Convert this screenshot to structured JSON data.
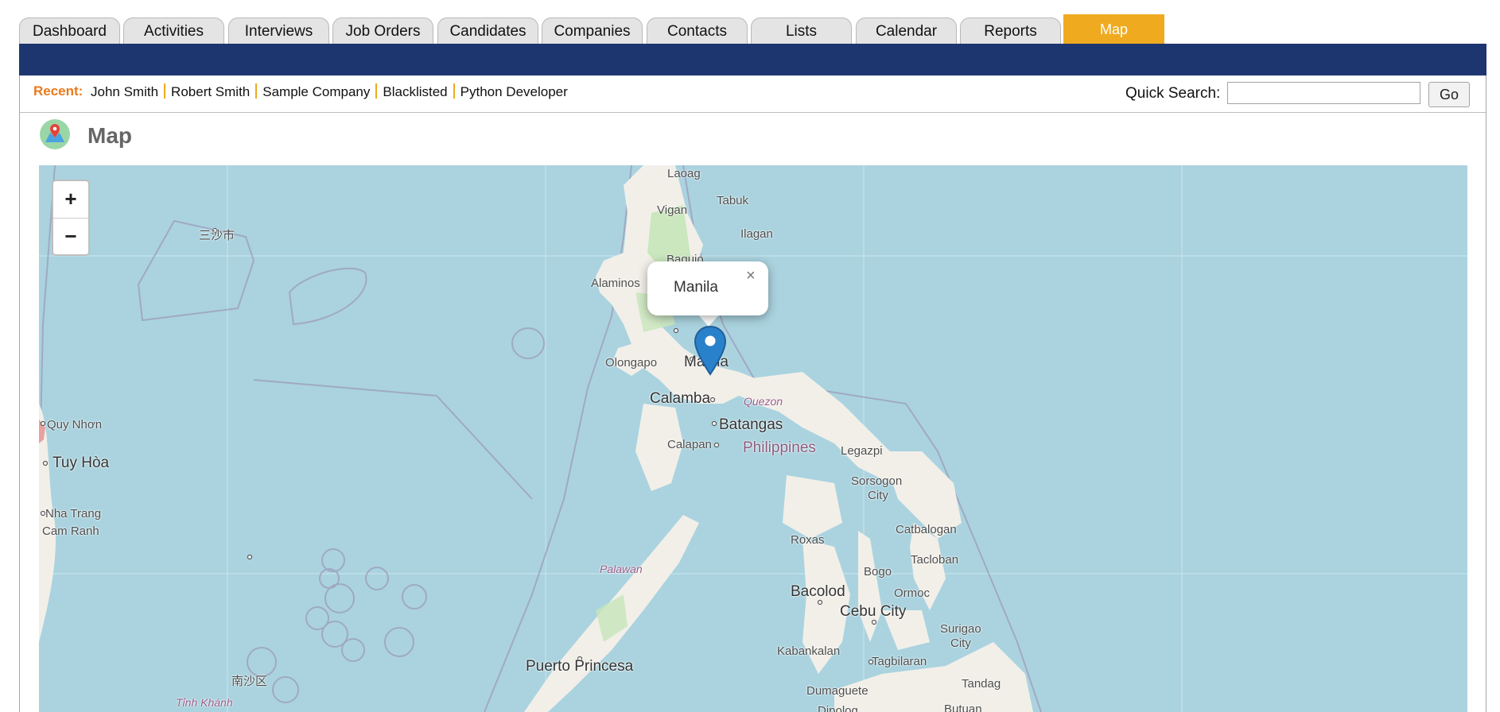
{
  "tabs": [
    {
      "label": "Dashboard"
    },
    {
      "label": "Activities"
    },
    {
      "label": "Interviews"
    },
    {
      "label": "Job Orders"
    },
    {
      "label": "Candidates"
    },
    {
      "label": "Companies"
    },
    {
      "label": "Contacts"
    },
    {
      "label": "Lists"
    },
    {
      "label": "Calendar"
    },
    {
      "label": "Reports"
    },
    {
      "label": "Map",
      "active": true
    }
  ],
  "recent": {
    "label": "Recent:",
    "items": [
      "John Smith",
      "Robert Smith",
      "Sample Company",
      "Blacklisted",
      "Python Developer"
    ]
  },
  "quick_search": {
    "label": "Quick Search:",
    "value": "",
    "button": "Go"
  },
  "page": {
    "title": "Map",
    "icon": "map-pin-icon"
  },
  "map": {
    "zoom_in": "+",
    "zoom_out": "−",
    "popup": {
      "text": "Manila",
      "close": "×"
    },
    "labels": {
      "laoag": "Laoag",
      "vigan": "Vigan",
      "tabuk": "Tabuk",
      "ilagan": "Ilagan",
      "baguio": "Baguio",
      "alaminos": "Alaminos",
      "olongapo": "Olongapo",
      "manila": "Manila",
      "calamba": "Calamba",
      "quezon": "Quezon",
      "batangas": "Batangas",
      "calapan": "Calapan",
      "philippines": "Philippines",
      "legazpi": "Legazpi",
      "sorsogon": "Sorsogon",
      "city": "City",
      "catbalogan": "Catbalogan",
      "tacloban": "Tacloban",
      "roxas": "Roxas",
      "bogo": "Bogo",
      "ormoc": "Ormoc",
      "bacolod": "Bacolod",
      "cebu": "Cebu City",
      "surigao": "Surigao",
      "surigao_city": "City",
      "palawan": "Palawan",
      "puerto": "Puerto Princesa",
      "kabankalan": "Kabankalan",
      "tagbilaran": "Tagbilaran",
      "tandag": "Tandag",
      "dumaguete": "Dumaguete",
      "dipolog": "Dipolog",
      "butuan": "Butuan",
      "sansha": "三沙市",
      "nansha": "南沙区",
      "tinhkhanh": "Tỉnh Khánh",
      "quynhon": "Quy Nhơn",
      "tuyhoa": "Tuy Hòa",
      "nhatrang": "Nha Trang",
      "camranh": "Cam Ranh"
    }
  },
  "colors": {
    "nav": "#1e3670",
    "active_tab": "#efaa1f",
    "recent_label": "#ea7a1b",
    "water": "#aad3df",
    "land": "#f2efe9",
    "marker": "#2a81cb"
  }
}
